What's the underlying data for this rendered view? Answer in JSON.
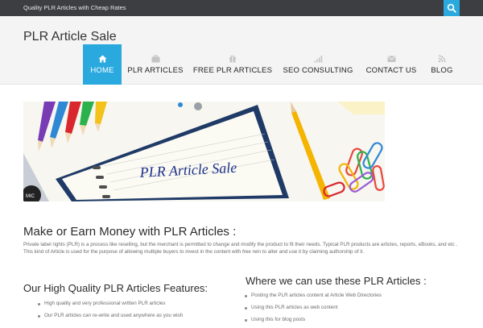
{
  "topbar": {
    "tagline": "Quality PLR Articles with Cheap Rates",
    "search_icon": "search-icon"
  },
  "header": {
    "site_title": "PLR Article Sale"
  },
  "nav": {
    "items": [
      {
        "label": "HOME",
        "icon": "home-icon",
        "active": true
      },
      {
        "label": "PLR ARTICLES",
        "icon": "briefcase-icon"
      },
      {
        "label": "FREE PLR ARTICLES",
        "icon": "gift-icon"
      },
      {
        "label": "SEO CONSULTING",
        "icon": "signal-bars-icon"
      },
      {
        "label": "CONTACT US",
        "icon": "envelope-icon"
      },
      {
        "label": "BLOG",
        "icon": "rss-icon"
      }
    ],
    "active_color": "#2aa9df"
  },
  "hero": {
    "banner_text": "PLR Article Sale",
    "badge_text": "MIC"
  },
  "main": {
    "heading": "Make or Earn Money with PLR Articles :",
    "paragraph": "Private label rights (PLR) is a process like reselling, but the merchant is permitted to change and modify the product to fit their needs. Typical PLR products are articles, reports, eBooks, and etc . This kind of Article is used for the purpose of allowing multiple buyers to invest in the content with free rein to alter and use it by claiming authorship of it.",
    "features_heading": "Our High Quality PLR Articles Features:",
    "features": [
      "High quality and very professional written PLR articles",
      "Our PLR articles can re-write and used anywhere as you wish"
    ],
    "uses_heading": "Where we can use these PLR Articles :",
    "uses": [
      "Posting the PLR articles content at Article Web Directories",
      "Using this PLR articles as web content",
      "Using this for  blog posts"
    ]
  },
  "colors": {
    "topbar": "#3c3e41",
    "accent": "#2aa9df",
    "header_bg": "#f4f4f4"
  }
}
